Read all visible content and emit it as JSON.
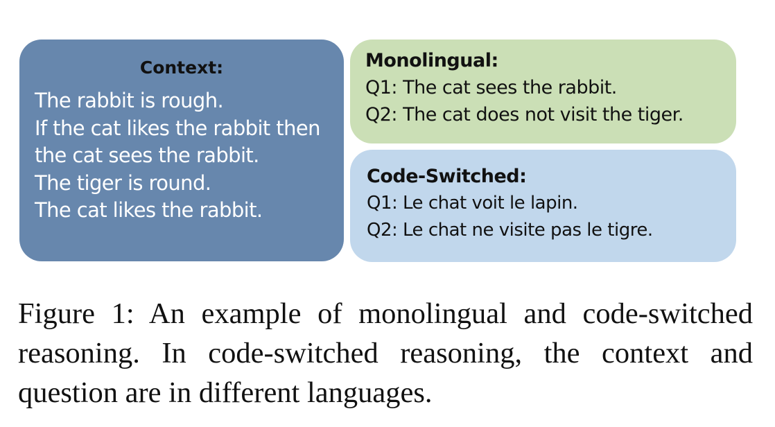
{
  "context": {
    "title": "Context:",
    "lines": [
      "The rabbit is rough.",
      "If the cat likes the rabbit then",
      "the cat sees the rabbit.",
      "The tiger is round.",
      "The cat likes the rabbit."
    ]
  },
  "monolingual": {
    "title": "Monolingual:",
    "questions": [
      "Q1:  The cat sees the rabbit.",
      "Q2:  The cat does not visit the tiger."
    ]
  },
  "code_switched": {
    "title": "Code-Switched:",
    "questions": [
      "Q1: Le chat voit le lapin.",
      "Q2: Le chat ne visite pas le tigre."
    ]
  },
  "caption": {
    "text": "Figure 1:  An example of monolingual and code-switched reasoning.  In code-switched reasoning, the context and question are in different languages."
  },
  "colors": {
    "context_bg": "#6787ad",
    "monolingual_bg": "#cbdfb6",
    "code_switched_bg": "#c1d7ec"
  }
}
